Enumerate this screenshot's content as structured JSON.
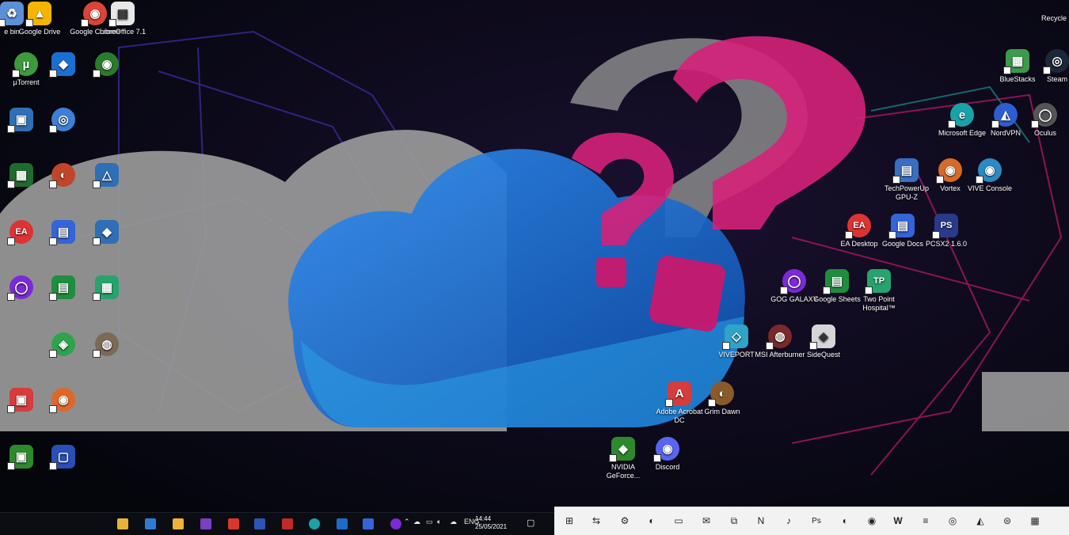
{
  "desktop": {
    "left_icons": [
      {
        "label": "e bin",
        "glyph": "♻",
        "color": "#5b8fd6"
      },
      {
        "label": "Google Drive",
        "glyph": "▲",
        "color": "#f4b400"
      },
      {
        "label": "Google Chrome",
        "glyph": "◉",
        "color": "#db4437"
      },
      {
        "label": "LibreOffice 7.1",
        "glyph": "▤",
        "color": "#e8e8e8"
      },
      {
        "label": "µTorrent",
        "glyph": "µ",
        "color": "#3c9b3c"
      },
      {
        "label": "",
        "glyph": "◆",
        "color": "#1b6fd1"
      },
      {
        "label": "",
        "glyph": "◉",
        "color": "#2a7c2a"
      },
      {
        "label": "",
        "glyph": "▣",
        "color": "#2e6fb6"
      },
      {
        "label": "",
        "glyph": "◎",
        "color": "#3d7fd6"
      },
      {
        "label": "",
        "glyph": "▦",
        "color": "#1f6b2b"
      },
      {
        "label": "",
        "glyph": "◐",
        "color": "#c1442c"
      },
      {
        "label": "",
        "glyph": "△",
        "color": "#2e6fb6"
      },
      {
        "label": "",
        "glyph": "EA",
        "color": "#d33"
      },
      {
        "label": "",
        "glyph": "▤",
        "color": "#3464d8"
      },
      {
        "label": "",
        "glyph": "◆",
        "color": "#2e6fb6"
      },
      {
        "label": "",
        "glyph": "◯",
        "color": "#7b2ad6"
      },
      {
        "label": "",
        "glyph": "▤",
        "color": "#1e8e3e"
      },
      {
        "label": "",
        "glyph": "▦",
        "color": "#27a36d"
      },
      {
        "label": "",
        "glyph": "◈",
        "color": "#2fa34b"
      },
      {
        "label": "",
        "glyph": "◍",
        "color": "#7a6a56"
      },
      {
        "label": "",
        "glyph": "▣",
        "color": "#d63c3c"
      },
      {
        "label": "",
        "glyph": "◉",
        "color": "#e0672a"
      },
      {
        "label": "",
        "glyph": "▣",
        "color": "#2c8a2c"
      },
      {
        "label": "",
        "glyph": "▢",
        "color": "#2a4fb8"
      }
    ],
    "right_icons": [
      {
        "label": "Recycle",
        "glyph": "♻",
        "color": "#7a7a7a"
      },
      {
        "label": "BlueStacks",
        "glyph": "▦",
        "color": "#3b9a4b"
      },
      {
        "label": "Steam",
        "glyph": "◎",
        "color": "#1b2838"
      },
      {
        "label": "Microsoft Edge",
        "glyph": "e",
        "color": "#1ba2a8"
      },
      {
        "label": "NordVPN",
        "glyph": "◭",
        "color": "#2c5ed1"
      },
      {
        "label": "Oculus",
        "glyph": "◯",
        "color": "#555"
      },
      {
        "label": "TechPowerUp GPU-Z",
        "glyph": "▤",
        "color": "#3a6ec0"
      },
      {
        "label": "Vortex",
        "glyph": "◉",
        "color": "#d46b2a"
      },
      {
        "label": "VIVE Console",
        "glyph": "◉",
        "color": "#2a8ac1"
      },
      {
        "label": "EA Desktop",
        "glyph": "EA",
        "color": "#d33"
      },
      {
        "label": "Google Docs",
        "glyph": "▤",
        "color": "#3464d8"
      },
      {
        "label": "PCSX2 1.6.0",
        "glyph": "PS",
        "color": "#2a3a8a"
      },
      {
        "label": "GOG GALAXY",
        "glyph": "◯",
        "color": "#7b2ad6"
      },
      {
        "label": "Google Sheets",
        "glyph": "▤",
        "color": "#1e8e3e"
      },
      {
        "label": "Two Point Hospital™",
        "glyph": "TP",
        "color": "#27a36d"
      },
      {
        "label": "VIVEPORT",
        "glyph": "◇",
        "color": "#2fa3c8"
      },
      {
        "label": "MSI Afterburner",
        "glyph": "◍",
        "color": "#7a2a2a"
      },
      {
        "label": "SideQuest",
        "glyph": "◈",
        "color": "#d6d6d6"
      },
      {
        "label": "Adobe Acrobat DC",
        "glyph": "A",
        "color": "#d63c3c"
      },
      {
        "label": "Grim Dawn",
        "glyph": "◐",
        "color": "#8a5a2a"
      },
      {
        "label": "NVIDIA GeForce...",
        "glyph": "◆",
        "color": "#2c8a2c"
      },
      {
        "label": "Discord",
        "glyph": "◉",
        "color": "#5865f2"
      }
    ]
  },
  "taskbar": {
    "tray_lang": "ENG",
    "clock_time": "14:44",
    "clock_date": "25/05/2021",
    "apps": [
      {
        "name": "file-explorer-app",
        "color": "#e8b13a"
      },
      {
        "name": "mail-app",
        "color": "#2e7bd6"
      },
      {
        "name": "folder-app",
        "color": "#f0b23a"
      },
      {
        "name": "onenote-app",
        "color": "#7b3fc1"
      },
      {
        "name": "office-app",
        "color": "#d8382a"
      },
      {
        "name": "word-app",
        "color": "#2b56b5"
      },
      {
        "name": "access-app",
        "color": "#c02a2a"
      },
      {
        "name": "edge-app",
        "color": "#1ba2a8"
      },
      {
        "name": "outlook-app",
        "color": "#1c6ac9"
      },
      {
        "name": "docs-app",
        "color": "#3464d8"
      },
      {
        "name": "gog-app",
        "color": "#7b2ad6"
      }
    ]
  },
  "quick_strip": {
    "buttons": [
      "⊞",
      "⇆",
      "⚙",
      "◐",
      "▭",
      "✉",
      "⧉",
      "N",
      "♪",
      "Ps",
      "◖",
      "◉",
      "W",
      "≡",
      "◎",
      "◭",
      "⊜",
      "▦"
    ]
  },
  "colors": {
    "cloud_blue": "#1e6fd6",
    "question_pink": "#d6217a",
    "grey_shape": "#9a9a9a"
  }
}
